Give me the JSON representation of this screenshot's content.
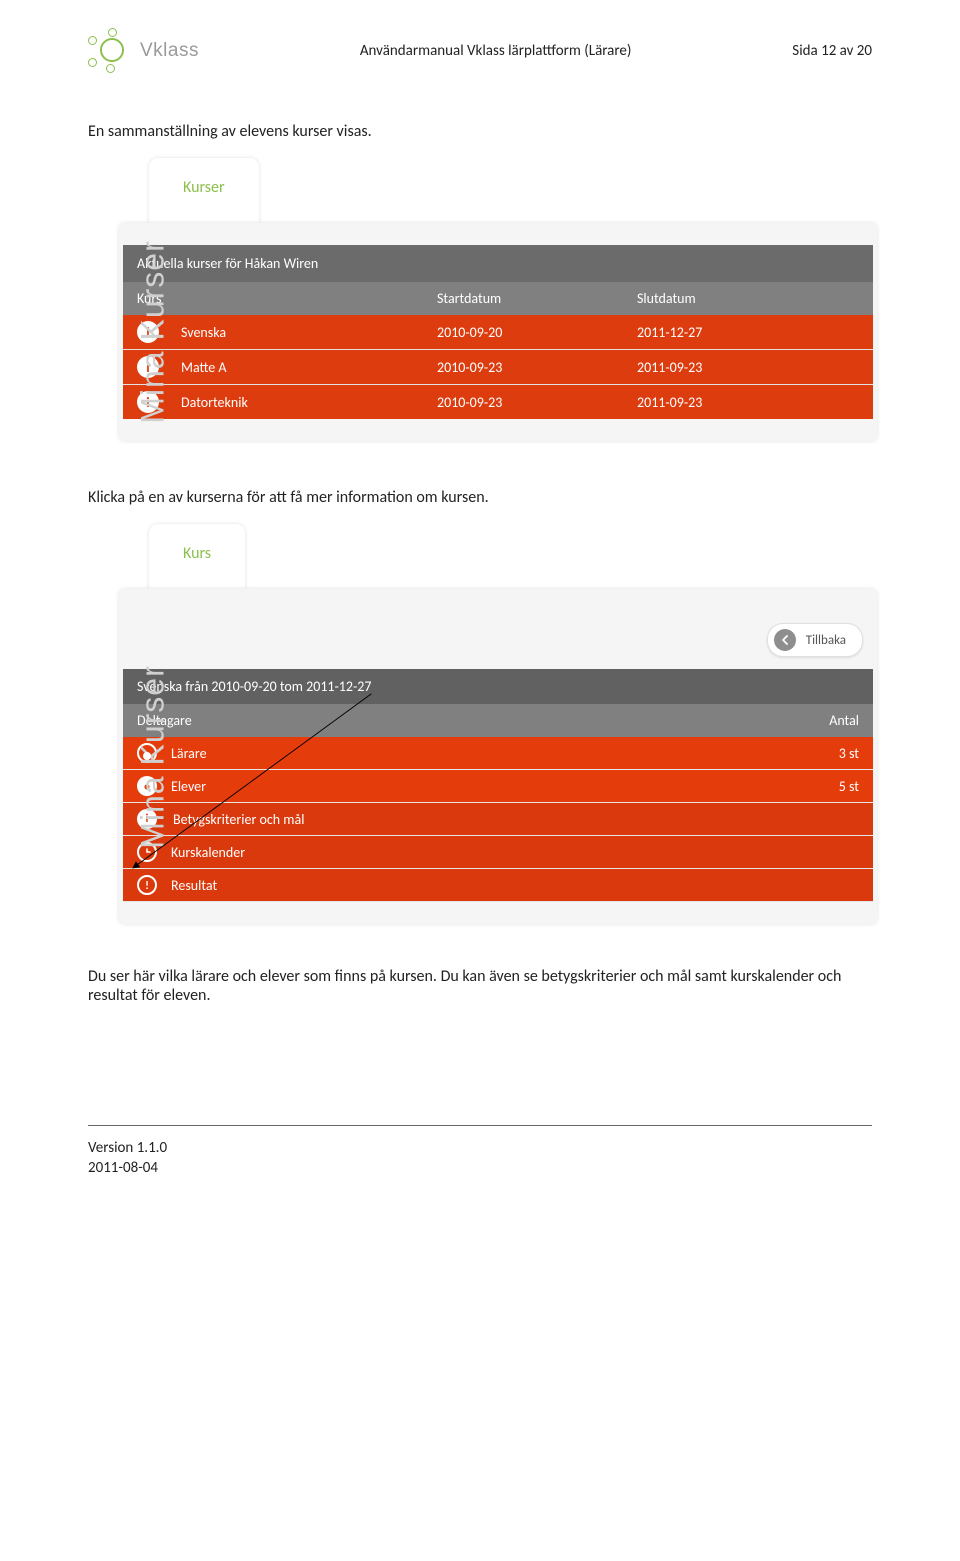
{
  "header": {
    "logo_text": "Vklass",
    "title": "Användarmanual Vklass lärplattform (Lärare)",
    "page_of": "Sida 12 av 20"
  },
  "para1": "En sammanställning av elevens kurser visas.",
  "screenshot1": {
    "side_label": "Mina Kurser",
    "tab": "Kurser",
    "title_bar": "Aktuella kurser för Håkan Wiren",
    "cols": {
      "course": "Kurs",
      "start": "Startdatum",
      "end": "Slutdatum"
    },
    "rows": [
      {
        "name": "Svenska",
        "start": "2010-09-20",
        "end": "2011-12-27"
      },
      {
        "name": "Matte A",
        "start": "2010-09-23",
        "end": "2011-09-23"
      },
      {
        "name": "Datorteknik",
        "start": "2010-09-23",
        "end": "2011-09-23"
      }
    ]
  },
  "para2": "Klicka på en av kurserna för att få mer information om kursen.",
  "screenshot2": {
    "side_label": "Mina Kurser",
    "tab": "Kurs",
    "back": "Tillbaka",
    "title_bar": "Svenska från 2010-09-20 tom 2011-12-27",
    "subhead": {
      "left": "Deltagare",
      "right": "Antal"
    },
    "rows": [
      {
        "label": "Lärare",
        "count": "3 st"
      },
      {
        "label": "Elever",
        "count": "5 st"
      },
      {
        "label": "Betygskriterier och mål",
        "count": ""
      },
      {
        "label": "Kurskalender",
        "count": ""
      },
      {
        "label": "Resultat",
        "count": ""
      }
    ]
  },
  "para3": "Du ser här vilka lärare och elever som finns på kursen. Du kan även se betygskriterier och mål samt kurskalender och resultat för eleven.",
  "footer": {
    "version": "Version 1.1.0",
    "date": "2011-08-04"
  }
}
